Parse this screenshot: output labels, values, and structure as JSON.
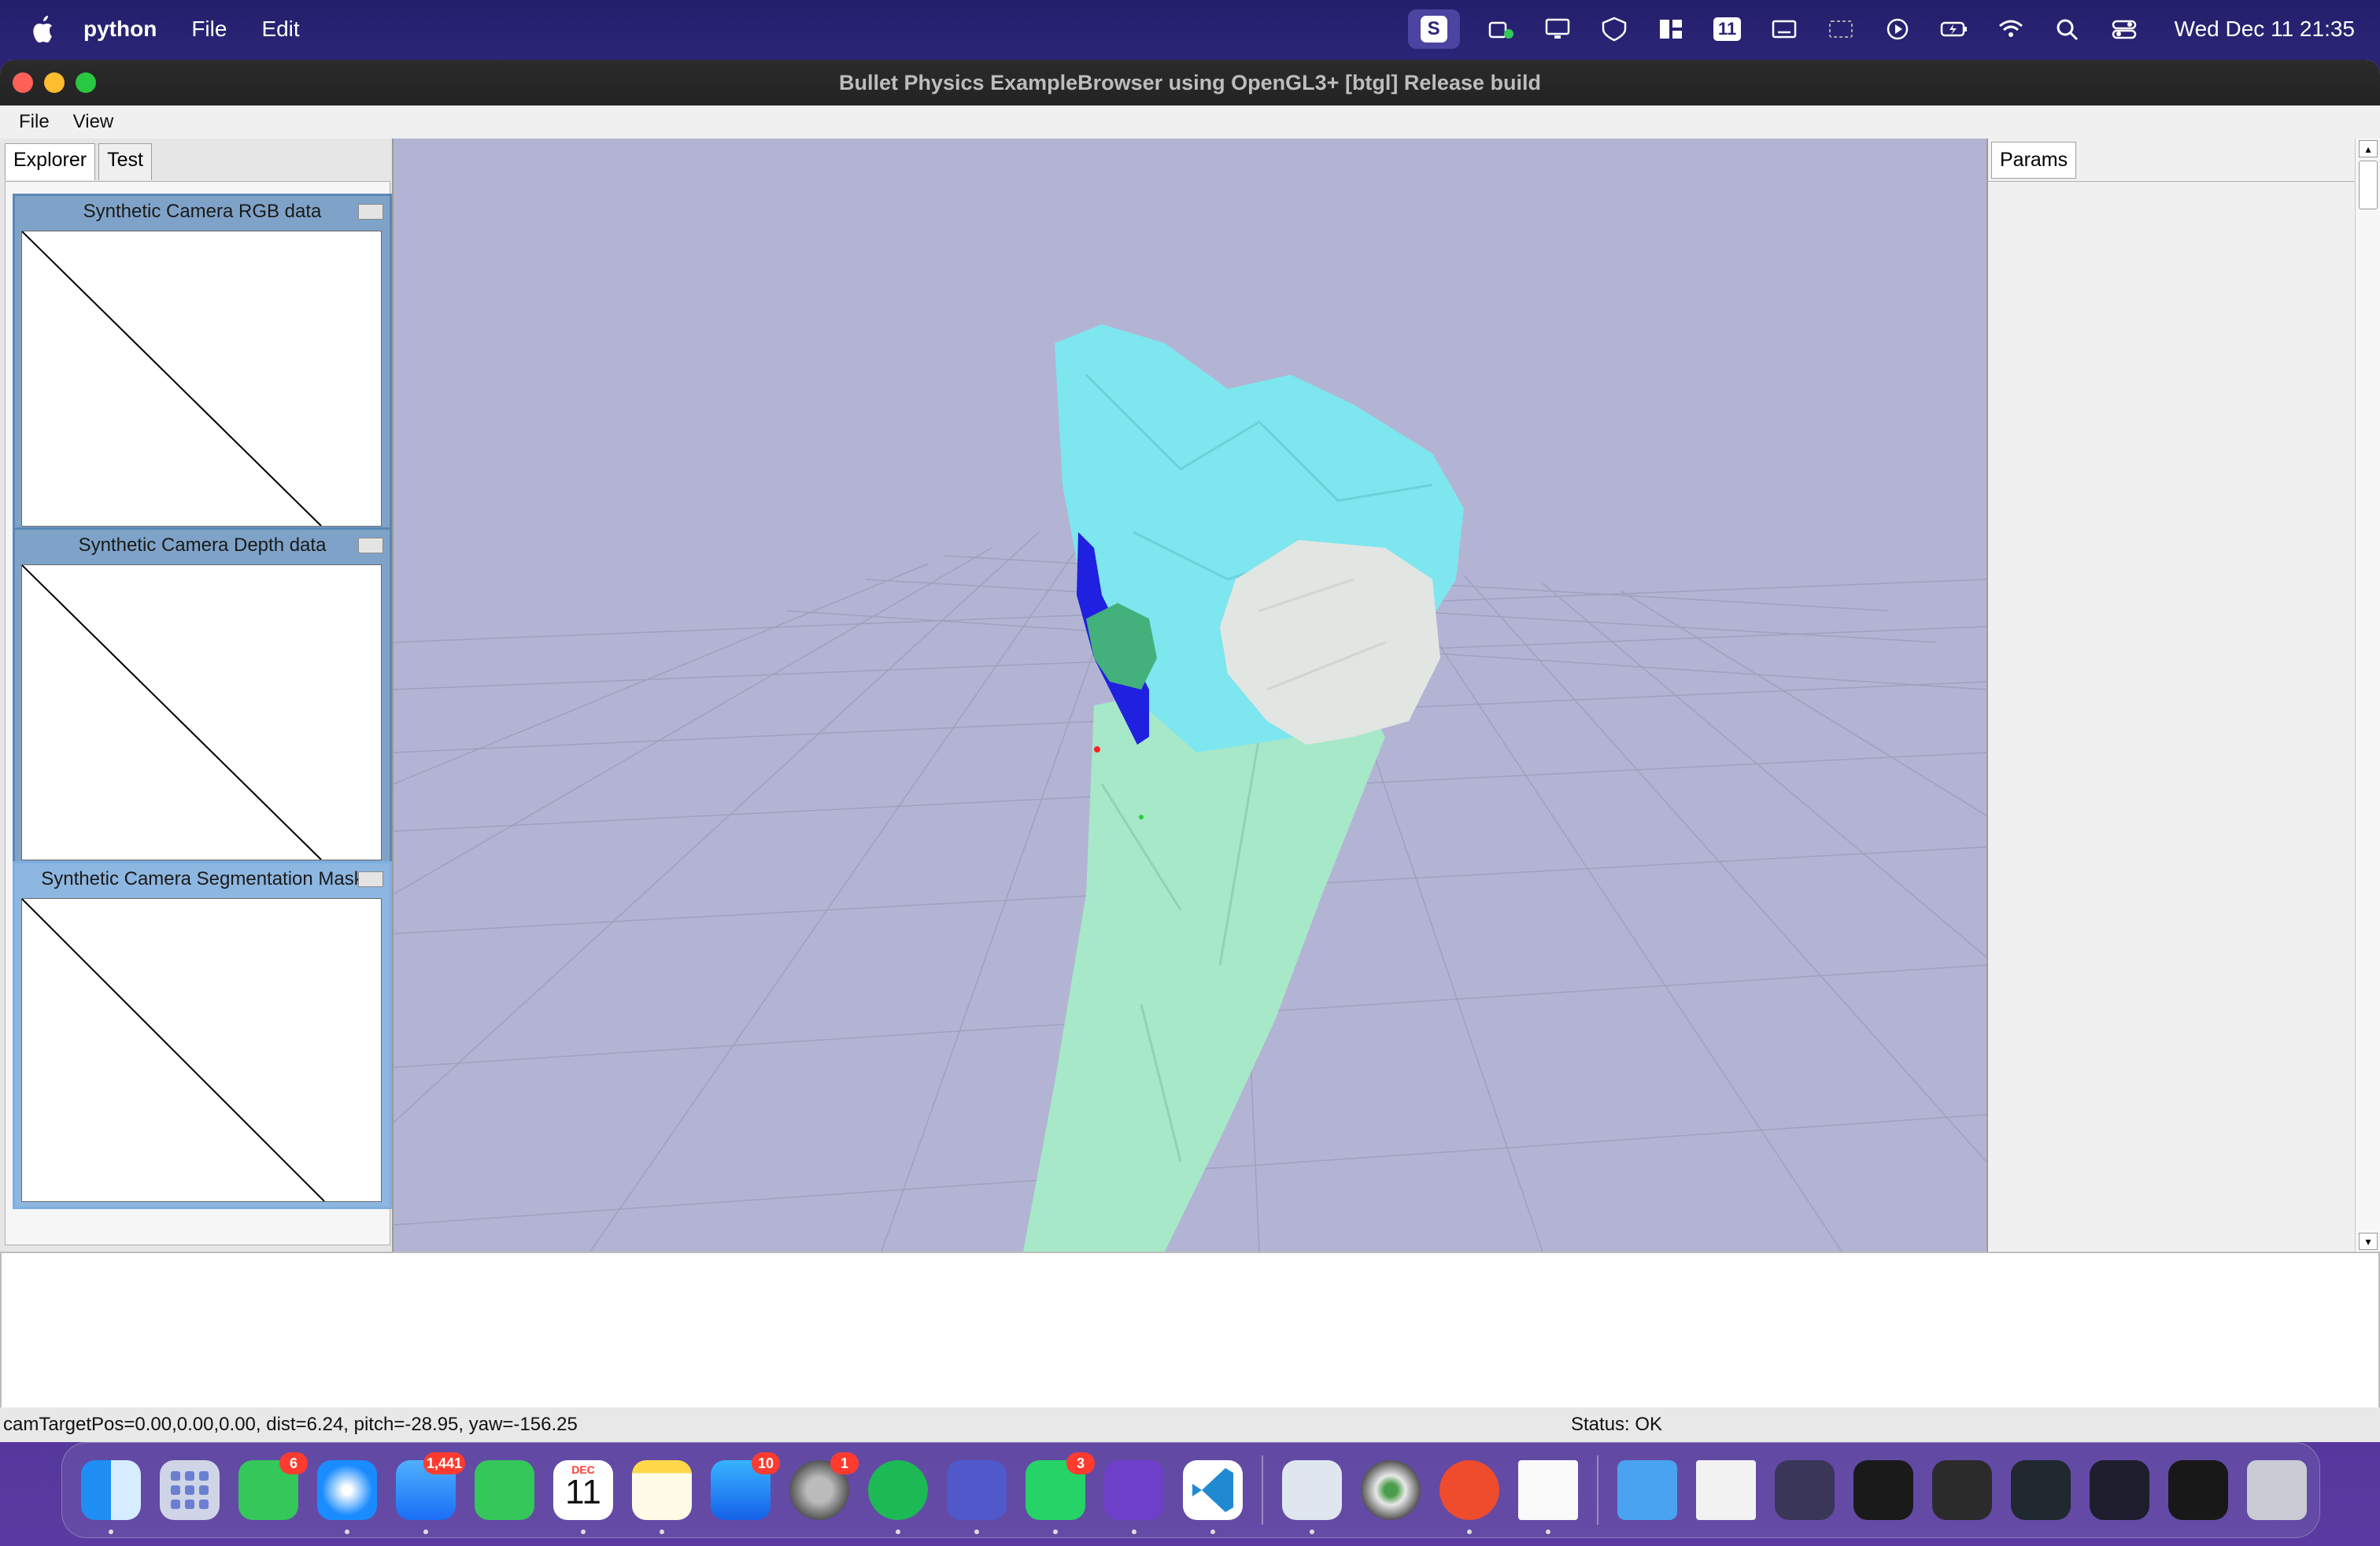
{
  "menubar": {
    "app_name": "python",
    "items": [
      "File",
      "Edit"
    ],
    "status_s": "S",
    "status_11": "11",
    "clock": "Wed Dec 11  21:35"
  },
  "window": {
    "title": "Bullet Physics ExampleBrowser using OpenGL3+ [btgl] Release build",
    "menu": [
      "File",
      "View"
    ]
  },
  "explorer": {
    "tabs": [
      "Explorer",
      "Test"
    ],
    "panels": [
      {
        "title": "Synthetic Camera RGB data"
      },
      {
        "title": "Synthetic Camera Depth data"
      },
      {
        "title": "Synthetic Camera Segmentation Mask"
      }
    ]
  },
  "params": {
    "tab": "Params"
  },
  "statusbar": {
    "camera": "camTargetPos=0.00,0.00,0.00, dist=6.24, pitch=-28.95, yaw=-156.25",
    "status": "Status: OK"
  },
  "dock": {
    "messages_badge": "6",
    "mail_badge": "1,441",
    "calendar_month": "DEC",
    "calendar_day": "11",
    "appstore_badge": "10",
    "settings_badge": "1",
    "whatsapp_badge": "3"
  },
  "colors": {
    "viewport_bg": "#b3b4d3",
    "femur": "#7ee6ee",
    "tibia": "#a6e8c8",
    "patella": "#e2e6e3",
    "ligament_blue": "#2020e0",
    "ligament_green": "#44b07c"
  }
}
